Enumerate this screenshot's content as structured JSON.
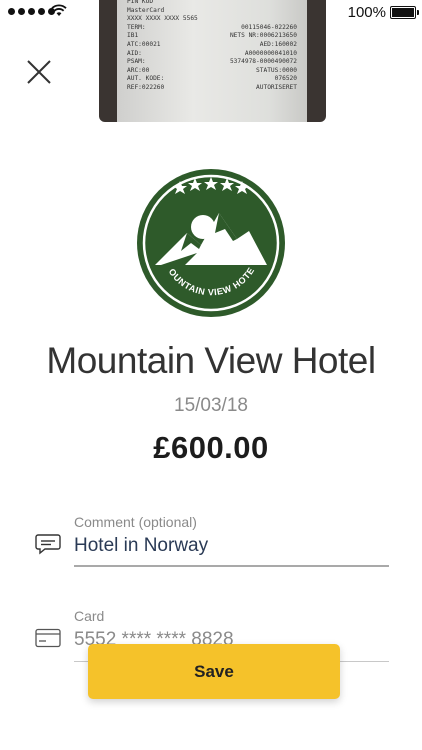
{
  "status_bar": {
    "battery_percent": "100%"
  },
  "receipt_lines": [
    [
      "PIN KOD",
      ""
    ],
    [
      "MasterCard",
      ""
    ],
    [
      "XXXX XXXX XXXX 5565",
      ""
    ],
    [
      "TERM:",
      "00115046-022260"
    ],
    [
      "IB1",
      "NETS NR:0006213650"
    ],
    [
      "ATC:00021",
      "AED:160002"
    ],
    [
      "AID:",
      "A0000000041010"
    ],
    [
      "PSAM:",
      "5374978-0000490072"
    ],
    [
      "ARC:00",
      "STATUS:0000"
    ],
    [
      "AUT. KODE:",
      "076520"
    ],
    [
      "REF:022260",
      "AUTORISERET"
    ]
  ],
  "logo": {
    "text": "MOUNTAIN VIEW HOTEL",
    "color": "#2e5a2a"
  },
  "merchant_name": "Mountain View Hotel",
  "date": "15/03/18",
  "amount": "£600.00",
  "comment": {
    "label": "Comment (optional)",
    "value": "Hotel in Norway"
  },
  "card": {
    "label": "Card",
    "value": "5552 **** **** 8828"
  },
  "save_label": "Save",
  "colors": {
    "accent": "#f5c22a",
    "text_value": "#2a3a55"
  }
}
